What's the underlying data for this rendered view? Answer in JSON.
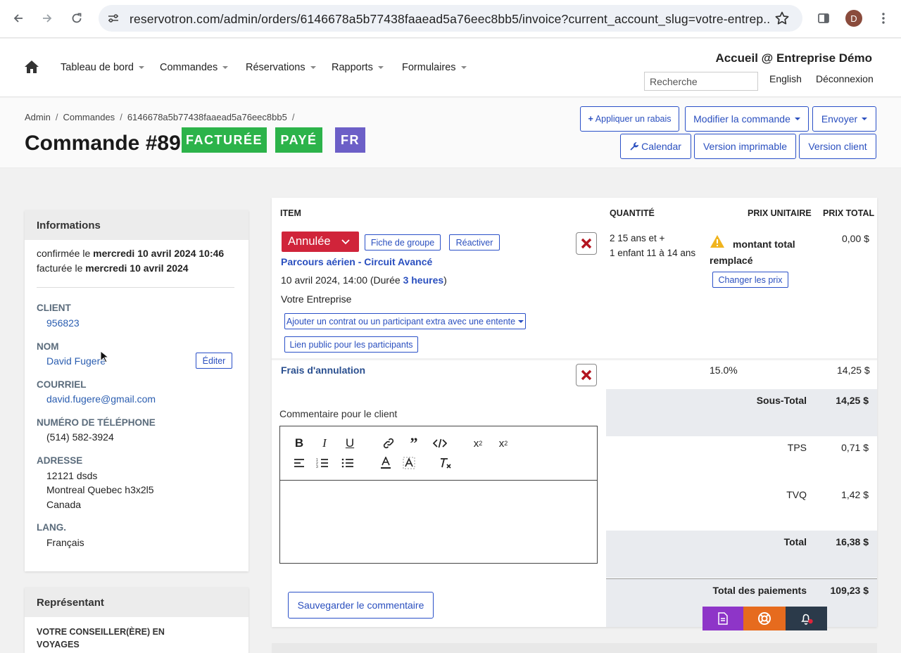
{
  "browser": {
    "url": "reservotron.com/admin/orders/6146678a5b77438faaead5a76eec8bb5/invoice?current_account_slug=votre-entrep...",
    "avatar_letter": "D"
  },
  "nav": {
    "items": [
      "Tableau de bord",
      "Commandes",
      "Réservations",
      "Rapports",
      "Formulaires"
    ],
    "org_title": "Accueil @ Entreprise Démo",
    "search_placeholder": "Recherche",
    "lang_link": "English",
    "logout": "Déconnexion"
  },
  "breadcrumb": [
    "Admin",
    "Commandes",
    "6146678a5b77438faaead5a76eec8bb5"
  ],
  "page_title": "Commande #89",
  "badges": [
    {
      "label": "FACTURÉE",
      "color": "#2cb34a"
    },
    {
      "label": "PAYÉ",
      "color": "#2cb34a"
    },
    {
      "label": "FR",
      "color": "#6c5fc7"
    }
  ],
  "actions": {
    "discount": "Appliquer un rabais",
    "modify": "Modifier la commande",
    "send": "Envoyer",
    "calendar": "Calendar",
    "printable": "Version imprimable",
    "client_version": "Version client"
  },
  "info": {
    "title": "Informations",
    "confirmed_prefix": "confirmée le",
    "confirmed_date": "mercredi 10 avril 2024 10:46",
    "invoiced_prefix": "facturée le",
    "invoiced_date": "mercredi 10 avril 2024",
    "client_label": "CLIENT",
    "client_value": "956823",
    "name_label": "NOM",
    "name_value": "David Fugere",
    "edit_button": "Éditer",
    "email_label": "COURRIEL",
    "email_value": "david.fugere@gmail.com",
    "phone_label": "NUMÉRO DE TÉLÉPHONE",
    "phone_value": "(514) 582-3924",
    "address_label": "ADRESSE",
    "address_line1": "12121 dsds",
    "address_line2": "Montreal Quebec h3x2l5",
    "address_line3": "Canada",
    "lang_label": "LANG.",
    "lang_value": "Français"
  },
  "rep": {
    "title": "Représentant",
    "label_line1": "VOTRE CONSEILLER(ÈRE) EN",
    "label_line2": "VOYAGES"
  },
  "invoice": {
    "headers": {
      "item": "ITEM",
      "qty": "QUANTITÉ",
      "unit": "PRIX UNITAIRE",
      "total": "PRIX TOTAL"
    },
    "status_dropdown": "Annulée",
    "status_color": "#d0243a",
    "group_sheet": "Fiche de groupe",
    "reactivate": "Réactiver",
    "product": "Parcours aérien - Circuit Avancé",
    "datetime_prefix": "10 avril 2024, 14:00 (Durée",
    "duration": "3 heures",
    "datetime_suffix": ")",
    "company": "Votre Entreprise",
    "add_contract": "Ajouter un contrat ou un participant extra avec une entente",
    "public_link": "Lien public pour les participants",
    "qty_line1": "2 15 ans et +",
    "qty_line2": "1 enfant 11 à 14 ans",
    "price_note_line1": "montant total",
    "price_note_line2": "remplacé",
    "change_prices": "Changer les prix",
    "line_total": "0,00 $",
    "fee_name": "Frais d'annulation",
    "fee_pct": "15.0%",
    "fee_total": "14,25 $",
    "comment_label": "Commentaire pour le client",
    "save_comment": "Sauvegarder le commentaire"
  },
  "totals": {
    "subtotal_label": "Sous-Total",
    "subtotal_value": "14,25 $",
    "tps_label": "TPS",
    "tps_value": "0,71 $",
    "tvq_label": "TVQ",
    "tvq_value": "1,42 $",
    "total_label": "Total",
    "total_value": "16,38 $",
    "payments_label": "Total des paiements",
    "payments_value": "109,23 $"
  },
  "floating": {
    "colors": [
      "#8e35c8",
      "#e66b1e",
      "#2b3a4a"
    ],
    "icons": [
      "document-icon",
      "lifebuoy-icon",
      "bell-icon"
    ]
  }
}
